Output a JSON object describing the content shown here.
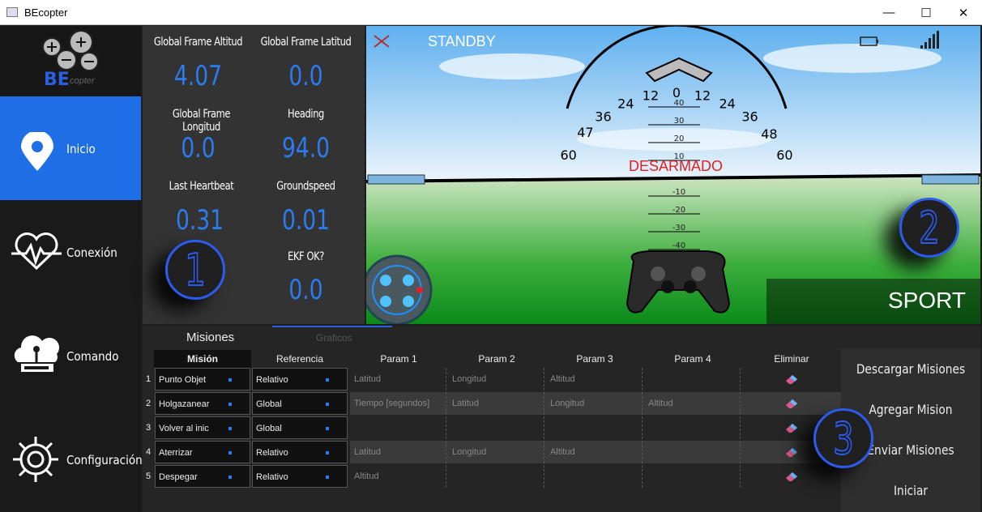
{
  "window": {
    "title": "BEcopter",
    "controls": [
      "minimize",
      "maximize",
      "close"
    ]
  },
  "logo": {
    "text": "BE",
    "subtext": "copter"
  },
  "sidebar": {
    "items": [
      {
        "label": "Inicio",
        "icon": "location-pin-icon",
        "active": true
      },
      {
        "label": "Conexión",
        "icon": "heartbeat-icon",
        "active": false
      },
      {
        "label": "Comando",
        "icon": "joystick-cloud-icon",
        "active": false
      },
      {
        "label": "Configuración",
        "icon": "gear-icon",
        "active": false
      }
    ]
  },
  "telemetry": {
    "global_frame_altitud": {
      "label": "Global Frame Altitud",
      "value": "4.07"
    },
    "global_frame_latitud": {
      "label": "Global Frame Latitud",
      "value": "0.0"
    },
    "global_frame_longitud": {
      "label": "Global Frame Longitud",
      "value": "0.0"
    },
    "heading": {
      "label": "Heading",
      "value": "94.0"
    },
    "last_heartbeat": {
      "label": "Last Heartbeat",
      "value": "0.31"
    },
    "groundspeed": {
      "label": "Groundspeed",
      "value": "0.01"
    },
    "ekf_ok": {
      "label": "EKF OK?",
      "value": "0.0"
    }
  },
  "hud": {
    "status": "STANDBY",
    "armed_text": "DESARMADO",
    "mode": "SPORT",
    "roll_scale": [
      "60",
      "47",
      "36",
      "24",
      "12",
      "0",
      "12",
      "24",
      "36",
      "48",
      "60"
    ],
    "pitch_scale": [
      "40",
      "30",
      "20",
      "10",
      "-10",
      "-20",
      "-30",
      "-40"
    ]
  },
  "badges": {
    "telemetry": "1",
    "hud": "2",
    "missions": "3"
  },
  "missions": {
    "tabs": [
      {
        "label": "Misiones",
        "active": true
      },
      {
        "label": "Graficos",
        "active": false
      }
    ],
    "columns": [
      "Misión",
      "Referencia",
      "Param 1",
      "Param 2",
      "Param 3",
      "Param 4",
      "Eliminar"
    ],
    "rows": [
      {
        "n": "1",
        "mision": "Punto Objet",
        "ref": "Relativo",
        "p1": "Latitud",
        "p2": "Longitud",
        "p3": "Altitud",
        "p4": ""
      },
      {
        "n": "2",
        "mision": "Holgazanear",
        "ref": "Global",
        "p1": "Tiempo [segundos]",
        "p2": "Latitud",
        "p3": "Longitud",
        "p4": "Altitud"
      },
      {
        "n": "3",
        "mision": "Volver al inic",
        "ref": "Global",
        "p1": "",
        "p2": "",
        "p3": "",
        "p4": ""
      },
      {
        "n": "4",
        "mision": "Aterrizar",
        "ref": "Relativo",
        "p1": "Latitud",
        "p2": "Longitud",
        "p3": "Altitud",
        "p4": ""
      },
      {
        "n": "5",
        "mision": "Despegar",
        "ref": "Relativo",
        "p1": "Altitud",
        "p2": "",
        "p3": "",
        "p4": ""
      }
    ],
    "buttons": [
      "Descargar Misiones",
      "Agregar Mision",
      "Enviar Misiones",
      "Iniciar"
    ]
  },
  "colors": {
    "accent": "#2a7cf0",
    "active_nav": "#1e6fe6",
    "armed_text": "#e02020",
    "badge": "#2c5bf0"
  }
}
